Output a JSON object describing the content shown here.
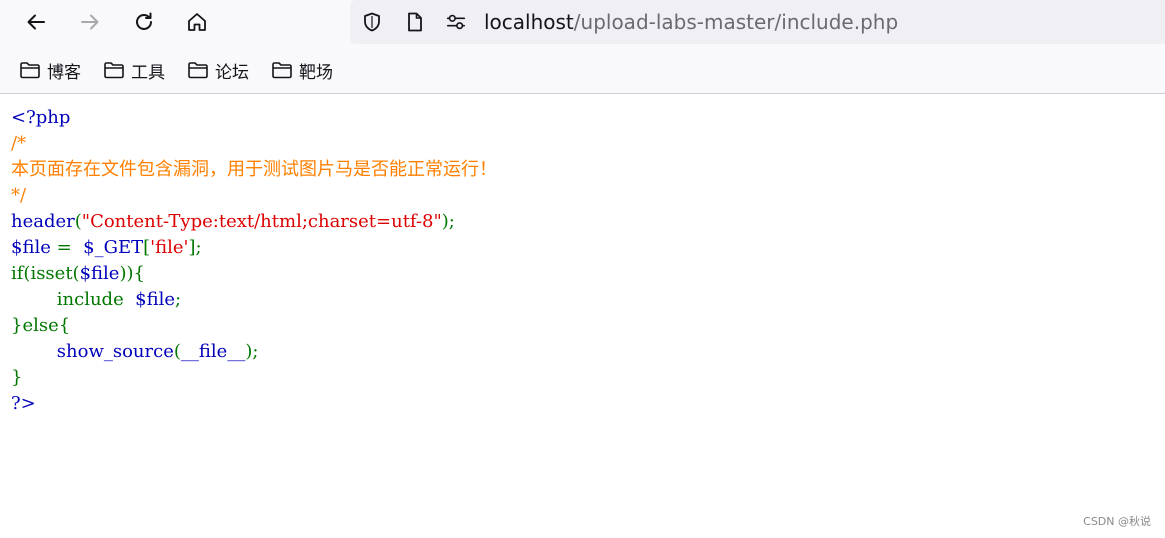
{
  "browser": {
    "url_host": "localhost",
    "url_path": "/upload-labs-master/include.php"
  },
  "bookmarks": [
    {
      "label": "博客"
    },
    {
      "label": "工具"
    },
    {
      "label": "论坛"
    },
    {
      "label": "靶场"
    }
  ],
  "colors": {
    "default": "#0000bb",
    "comment": "#ff8000",
    "keyword": "#007700",
    "string": "#dd0000"
  },
  "code_lines": [
    [
      {
        "text": "<?php",
        "color": "#0000bb"
      }
    ],
    [
      {
        "text": "/*",
        "color": "#ff8000"
      }
    ],
    [
      {
        "text": "本页面存在文件包含漏洞，用于测试图片马是否能正常运行！",
        "color": "#ff8000"
      }
    ],
    [
      {
        "text": "*/",
        "color": "#ff8000"
      }
    ],
    [
      {
        "text": "header",
        "color": "#0000bb"
      },
      {
        "text": "(",
        "color": "#007700"
      },
      {
        "text": "\"Content-Type:text/html;charset=utf-8\"",
        "color": "#dd0000"
      },
      {
        "text": ");",
        "color": "#007700"
      }
    ],
    [
      {
        "text": "$file ",
        "color": "#0000bb"
      },
      {
        "text": "= ",
        "color": "#007700"
      },
      {
        "text": " $_GET",
        "color": "#0000bb"
      },
      {
        "text": "[",
        "color": "#007700"
      },
      {
        "text": "'file'",
        "color": "#dd0000"
      },
      {
        "text": "];",
        "color": "#007700"
      }
    ],
    [
      {
        "text": "if(isset(",
        "color": "#007700"
      },
      {
        "text": "$file",
        "color": "#0000bb"
      },
      {
        "text": ")){",
        "color": "#007700"
      }
    ],
    [
      {
        "text": "        include  ",
        "color": "#007700"
      },
      {
        "text": "$file",
        "color": "#0000bb"
      },
      {
        "text": ";",
        "color": "#007700"
      }
    ],
    [
      {
        "text": "}else{",
        "color": "#007700"
      }
    ],
    [
      {
        "text": "        ",
        "color": "#007700"
      },
      {
        "text": "show_source",
        "color": "#0000bb"
      },
      {
        "text": "(",
        "color": "#007700"
      },
      {
        "text": "__file__",
        "color": "#0000bb"
      },
      {
        "text": ");",
        "color": "#007700"
      }
    ],
    [
      {
        "text": "}",
        "color": "#007700"
      }
    ],
    [
      {
        "text": "?>",
        "color": "#0000bb"
      }
    ]
  ],
  "watermark": "CSDN @秋说"
}
